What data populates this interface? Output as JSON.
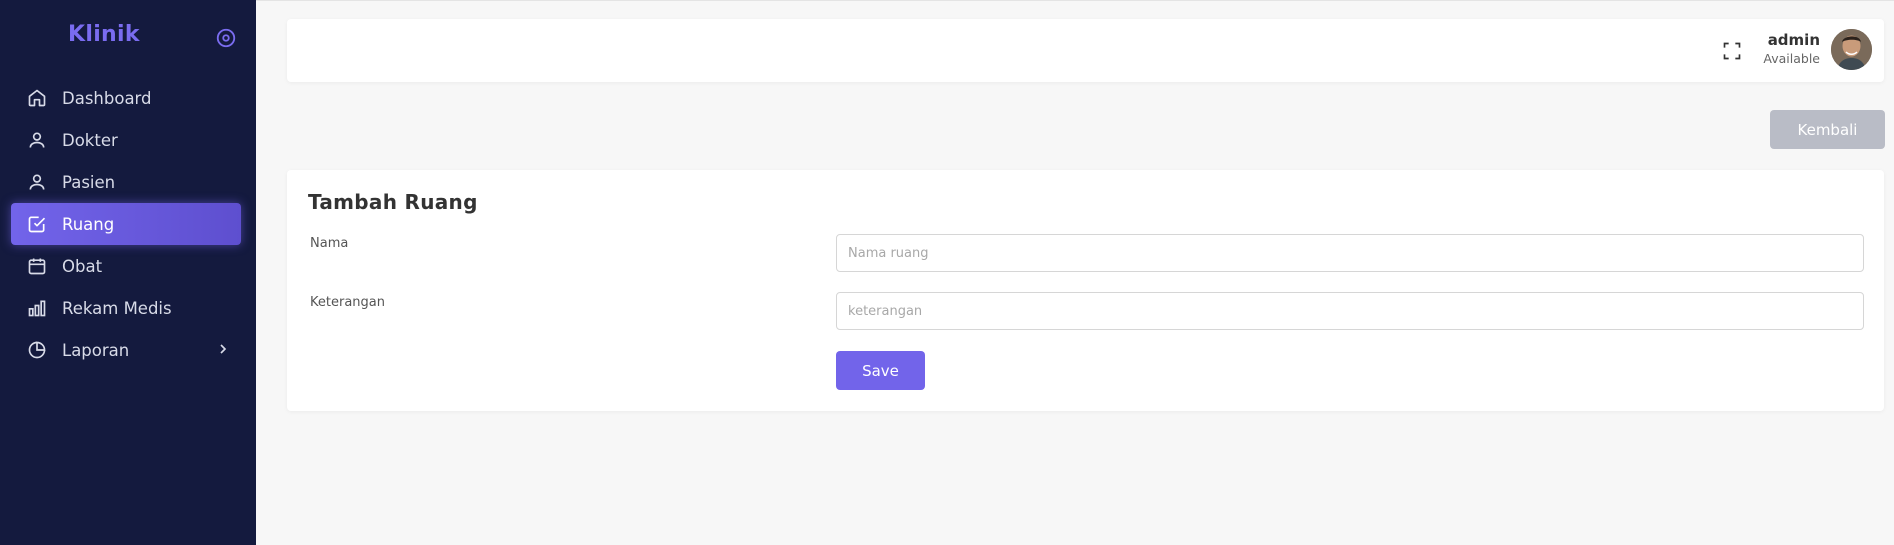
{
  "sidebar": {
    "brand": "Klinik",
    "items": [
      {
        "label": "Dashboard",
        "icon": "home-icon"
      },
      {
        "label": "Dokter",
        "icon": "user-icon"
      },
      {
        "label": "Pasien",
        "icon": "user-icon"
      },
      {
        "label": "Ruang",
        "icon": "check-square-icon",
        "active": true
      },
      {
        "label": "Obat",
        "icon": "calendar-icon"
      },
      {
        "label": "Rekam Medis",
        "icon": "bar-chart-icon"
      },
      {
        "label": "Laporan",
        "icon": "pie-chart-icon",
        "has_submenu": true
      }
    ]
  },
  "header": {
    "user_name": "admin",
    "user_status": "Available"
  },
  "actions": {
    "back_label": "Kembali"
  },
  "form": {
    "title": "Tambah Ruang",
    "nama_label": "Nama",
    "nama_placeholder": "Nama ruang",
    "keterangan_label": "Keterangan",
    "keterangan_placeholder": "keterangan",
    "save_label": "Save"
  },
  "colors": {
    "sidebar_bg": "#141a3e",
    "accent": "#7264ea",
    "back_button": "#b9bcc6",
    "page_bg": "#f7f7f7"
  }
}
